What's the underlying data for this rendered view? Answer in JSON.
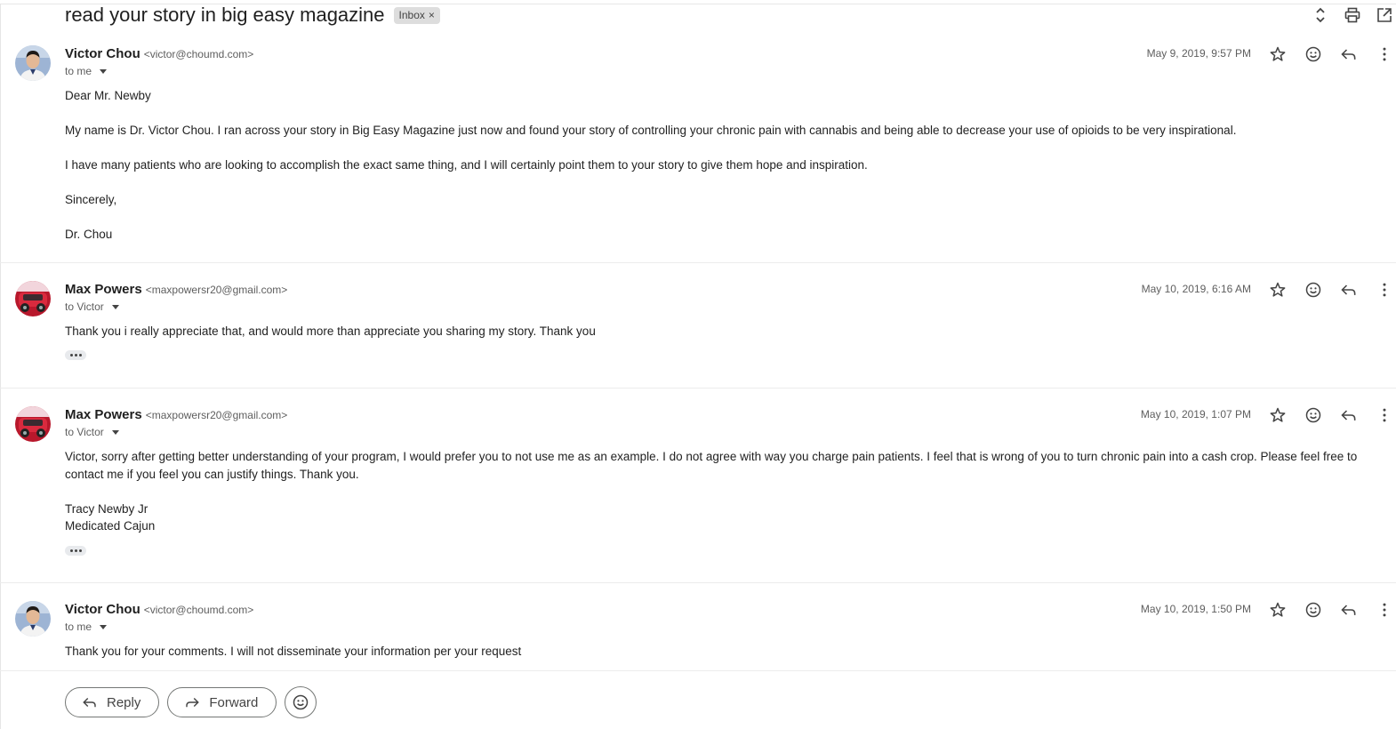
{
  "thread": {
    "subject": "read your story in big easy magazine",
    "label": "Inbox",
    "label_remove": "×"
  },
  "top_actions": [
    "expand-collapse-icon",
    "print-icon",
    "open-in-new-window-icon"
  ],
  "messages": [
    {
      "sender_name": "Victor Chou",
      "sender_email": "<victor@choumd.com>",
      "to": "to me",
      "date": "May 9, 2019, 9:57 PM",
      "body": {
        "greeting": "Dear Mr. Newby",
        "p1": "My name is Dr. Victor Chou.  I ran across your story in Big Easy Magazine just now and found your story of controlling your chronic pain with cannabis and being able to decrease your use of opioids to be very inspirational.",
        "p2": "I have many patients who are looking to accomplish the exact same thing, and I will certainly point them to your story to give them hope and inspiration.",
        "closing": "Sincerely,",
        "signature": "Dr. Chou"
      }
    },
    {
      "sender_name": "Max Powers",
      "sender_email": "<maxpowersr20@gmail.com>",
      "to": "to Victor",
      "date": "May 10, 2019, 6:16 AM",
      "body": {
        "p1": "Thank you i really appreciate that, and would more than appreciate you sharing my story. Thank you"
      }
    },
    {
      "sender_name": "Max Powers",
      "sender_email": "<maxpowersr20@gmail.com>",
      "to": "to Victor",
      "date": "May 10, 2019, 1:07 PM",
      "body": {
        "p1": "Victor, sorry after getting better understanding of your program, I would prefer you to not use me as an example. I do not agree with way you charge pain patients. I feel that is wrong of you to turn chronic pain into a cash crop. Please feel free to contact me if you feel you can justify things. Thank you.",
        "sig1": "Tracy Newby Jr",
        "sig2": "Medicated Cajun"
      }
    },
    {
      "sender_name": "Victor Chou",
      "sender_email": "<victor@choumd.com>",
      "to": "to me",
      "date": "May 10, 2019, 1:50 PM",
      "body": {
        "p1": "Thank you for your comments.  I will not disseminate your information per your request"
      }
    }
  ],
  "message_actions": [
    "star-icon",
    "emoji-react-icon",
    "reply-icon",
    "more-vert-icon"
  ],
  "footer": {
    "reply_label": "Reply",
    "forward_label": "Forward"
  },
  "colors": {
    "text": "#202124",
    "muted": "#5e5e5e",
    "chip_bg": "#dddddd",
    "border": "#747775"
  }
}
